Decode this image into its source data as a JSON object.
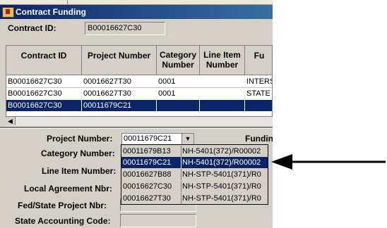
{
  "window": {
    "title": "Contract Funding"
  },
  "contract": {
    "label": "Contract ID:",
    "value": "B00016627C30"
  },
  "grid": {
    "headers": [
      "Contract ID",
      "Project Number",
      "Category Number",
      "Line Item Number",
      "Fu"
    ],
    "rows": [
      [
        "B00016627C30",
        "00016627T30",
        "0001",
        "",
        "INTERS"
      ],
      [
        "B00016627C30",
        "00016627T30",
        "0001",
        "",
        "STATE"
      ],
      [
        "B00016627C30",
        "00011679C21",
        "",
        "",
        ""
      ]
    ],
    "selected_row": 2
  },
  "form": {
    "project_number_label": "Project Number:",
    "project_number_value": "00011679C21",
    "funding_label": "Fundin",
    "category_number_label": "Category Number:",
    "line_item_number_label": "Line Item Number:",
    "local_agreement_label": "Local Agreement Nbr:",
    "fed_state_project_label": "Fed/State Project Nbr:",
    "state_accounting_label": "State Accounting Code:"
  },
  "dropdown": {
    "items": [
      [
        "00011679B13",
        "NH-5401(372)/R00002"
      ],
      [
        "00011679C21",
        "NH-5401(372)/R00002"
      ],
      [
        "00016627B88",
        "NH-STP-5401(371)/R0"
      ],
      [
        "00016627C30",
        "NH-STP-5401(371)/R0"
      ],
      [
        "00016627T30",
        "NH-STP-5401(371)/R0"
      ]
    ],
    "selected_index": 1
  },
  "icons": {
    "app": "app-icon",
    "dropdown_arrow": "chevron-down-icon",
    "scroll_left": "scroll-left-icon",
    "pointer": "arrow-left-icon"
  },
  "colors": {
    "selection": "#0a246a",
    "face": "#d4d0c8"
  }
}
